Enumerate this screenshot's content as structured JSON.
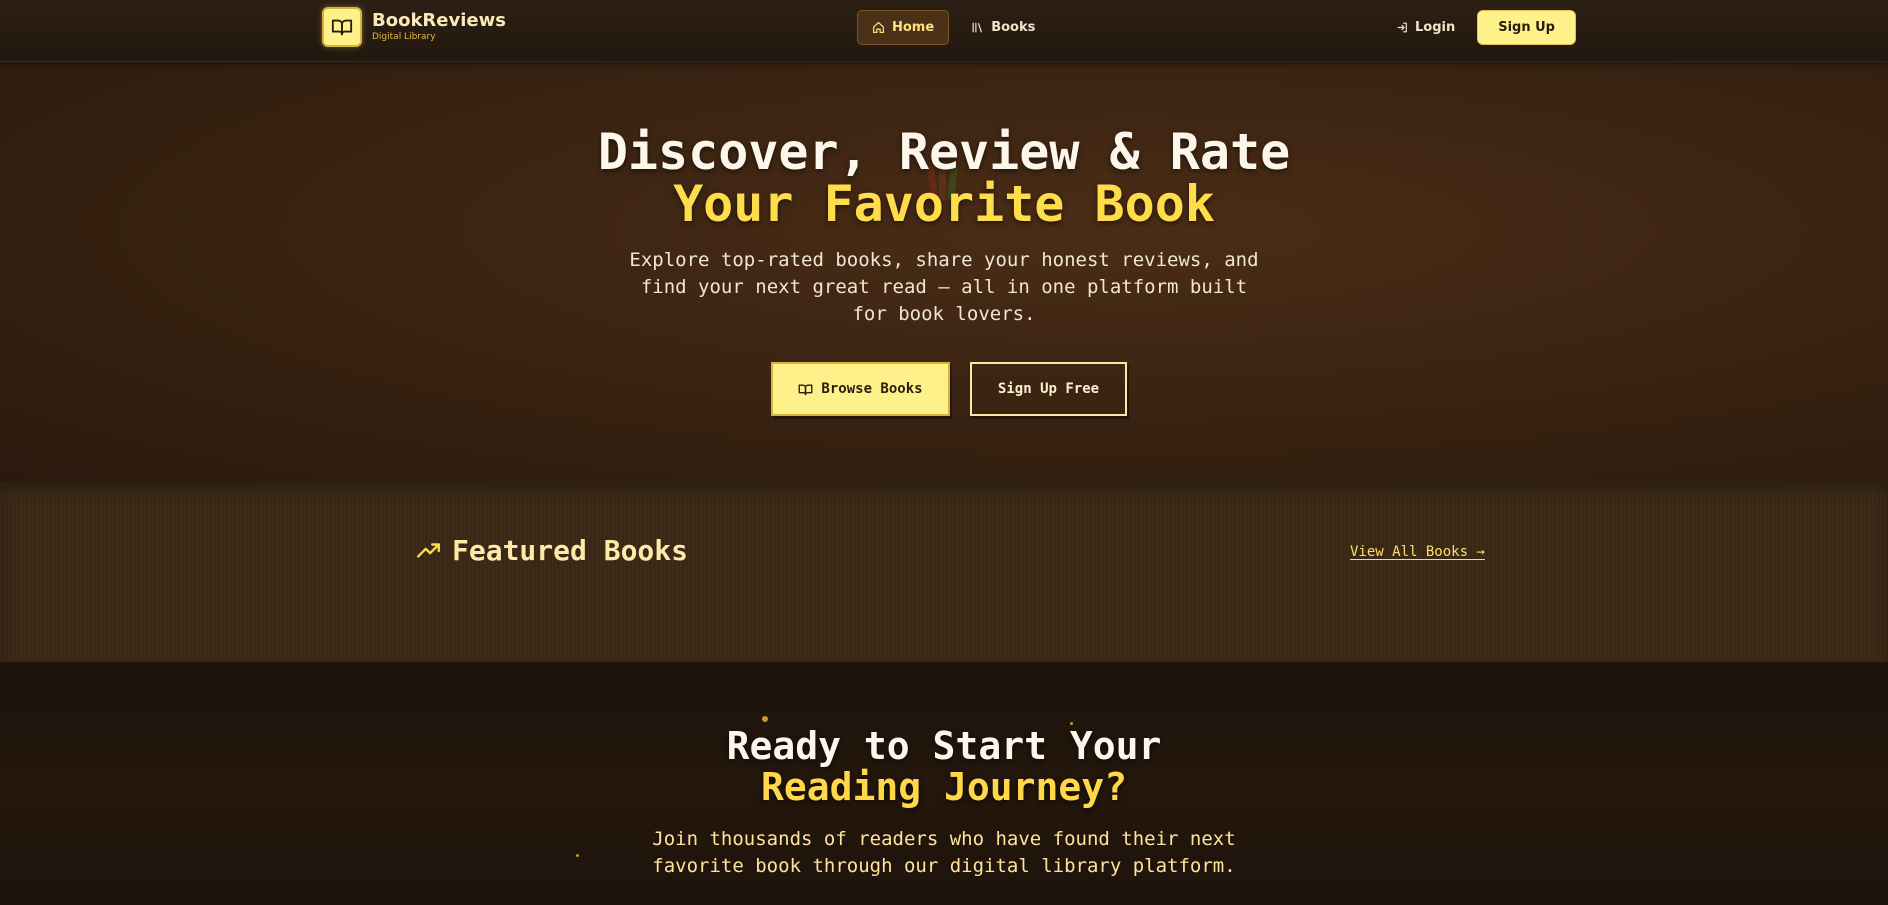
{
  "brand": {
    "name": "BookReviews",
    "tagline": "Digital Library",
    "logo_icon": "open-book-icon"
  },
  "nav": {
    "links": [
      {
        "label": "Home",
        "icon": "home-icon",
        "active": true
      },
      {
        "label": "Books",
        "icon": "library-icon",
        "active": false
      }
    ],
    "login_label": "Login",
    "signup_label": "Sign Up"
  },
  "hero": {
    "title_line1": "Discover, Review & Rate",
    "title_line2": "Your Favorite Book",
    "subtitle": "Explore top-rated books, share your honest reviews, and find your next great read — all in one platform built for book lovers.",
    "primary_button": "Browse Books",
    "secondary_button": "Sign Up Free"
  },
  "featured": {
    "title": "Featured Books",
    "view_all": "View All Books →",
    "icon": "trending-up-icon"
  },
  "cta": {
    "title_line1": "Ready to Start Your",
    "title_line2": "Reading Journey?",
    "subtitle": "Join thousands of readers who have found their next favorite book through our digital library platform."
  },
  "colors": {
    "accent_yellow": "#fff18a",
    "gold": "#ffdc4a",
    "background_dark": "#1f150c",
    "hero_brown": "#4b2d16"
  }
}
